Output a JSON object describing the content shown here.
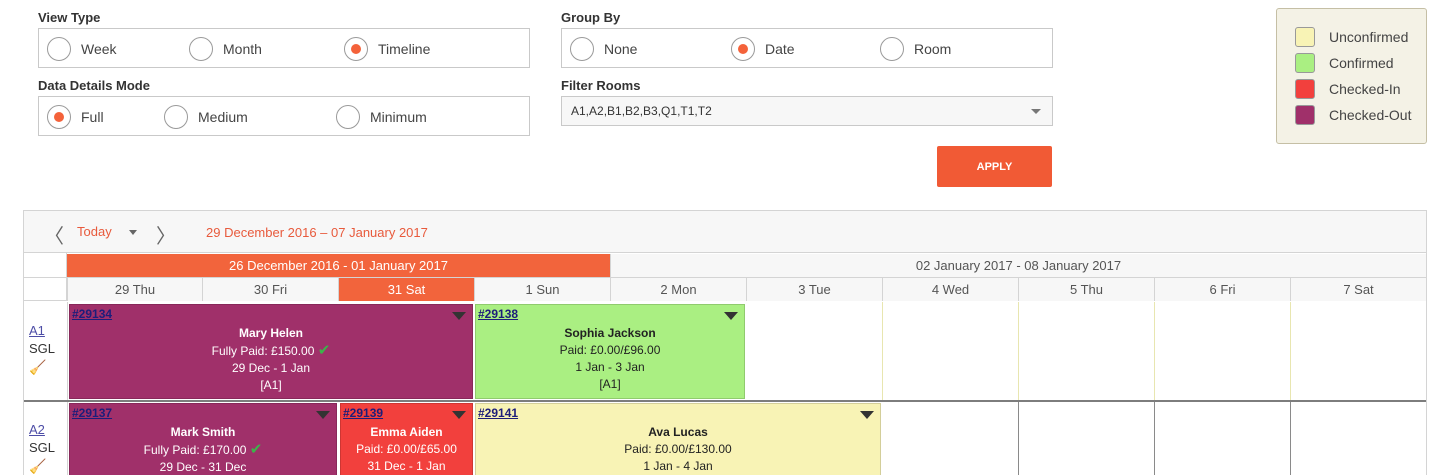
{
  "view_type": {
    "label": "View Type",
    "options": [
      {
        "label": "Week",
        "selected": false
      },
      {
        "label": "Month",
        "selected": false
      },
      {
        "label": "Timeline",
        "selected": true
      }
    ]
  },
  "group_by": {
    "label": "Group By",
    "options": [
      {
        "label": "None",
        "selected": false
      },
      {
        "label": "Date",
        "selected": true
      },
      {
        "label": "Room",
        "selected": false
      }
    ]
  },
  "details_mode": {
    "label": "Data Details Mode",
    "options": [
      {
        "label": "Full",
        "selected": true
      },
      {
        "label": "Medium",
        "selected": false
      },
      {
        "label": "Minimum",
        "selected": false
      }
    ]
  },
  "filter_rooms": {
    "label": "Filter Rooms",
    "value": "A1,A2,B1,B2,B3,Q1,T1,T2"
  },
  "apply_label": "APPLY",
  "legend": [
    {
      "label": "Unconfirmed",
      "color": "#f8f3b5"
    },
    {
      "label": "Confirmed",
      "color": "#aaef82"
    },
    {
      "label": "Checked-In",
      "color": "#f2403d"
    },
    {
      "label": "Checked-Out",
      "color": "#a0306a"
    }
  ],
  "toolbar": {
    "prev": "〈",
    "next": "〉",
    "today": "Today",
    "range": "29 December 2016 – 07 January 2017"
  },
  "weeks": [
    "26 December 2016 - 01 January 2017",
    "02 January 2017 - 08 January 2017"
  ],
  "days": [
    "29 Thu",
    "30 Fri",
    "31 Sat",
    "1 Sun",
    "2 Mon",
    "3 Tue",
    "4 Wed",
    "5 Thu",
    "6 Fri",
    "7 Sat"
  ],
  "rooms": [
    {
      "code": "A1",
      "type": "SGL",
      "icon": "broom-icon"
    },
    {
      "code": "A2",
      "type": "SGL",
      "icon": "broom-icon"
    }
  ],
  "bookings": {
    "b29134": {
      "id": "#29134",
      "name": "Mary Helen",
      "payment": "Fully Paid: £150.00",
      "dates": "29 Dec - 1 Jan",
      "room": "[A1]",
      "status": "Checked-Out"
    },
    "b29138": {
      "id": "#29138",
      "name": "Sophia Jackson",
      "payment": "Paid: £0.00/£96.00",
      "dates": "1 Jan - 3 Jan",
      "room": "[A1]",
      "status": "Confirmed"
    },
    "b29137": {
      "id": "#29137",
      "name": "Mark Smith",
      "payment": "Fully Paid: £170.00",
      "dates": "29 Dec - 31 Dec",
      "status": "Checked-Out"
    },
    "b29139": {
      "id": "#29139",
      "name": "Emma Aiden",
      "payment": "Paid: £0.00/£65.00",
      "dates": "31 Dec - 1 Jan",
      "status": "Checked-In"
    },
    "b29141": {
      "id": "#29141",
      "name": "Ava Lucas",
      "payment": "Paid: £0.00/£130.00",
      "dates": "1 Jan - 4 Jan",
      "status": "Unconfirmed"
    }
  }
}
